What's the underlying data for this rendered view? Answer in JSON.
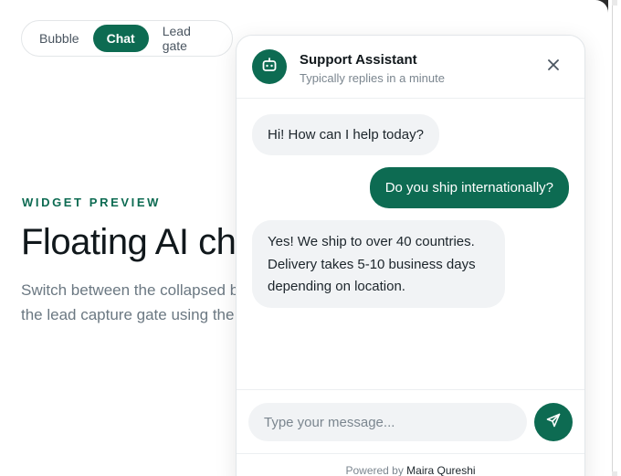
{
  "tabs": [
    {
      "label": "Bubble",
      "active": false
    },
    {
      "label": "Chat",
      "active": true
    },
    {
      "label": "Lead gate",
      "active": false
    }
  ],
  "hero": {
    "eyebrow": "WIDGET PREVIEW",
    "headline": "Floating AI cha",
    "desc_line1": "Switch between the collapsed b",
    "desc_line2": "the lead capture gate using the"
  },
  "widget": {
    "avatar_icon": "robot-icon",
    "title": "Support Assistant",
    "subtitle": "Typically replies in a minute",
    "close_icon": "close-icon",
    "messages": [
      {
        "role": "bot",
        "text": "Hi! How can I help today?"
      },
      {
        "role": "user",
        "text": "Do you ship internationally?"
      },
      {
        "role": "bot",
        "lines": [
          "Yes! We ship to over 40 countries.",
          "Delivery takes 5-10 business days",
          "depending on location."
        ]
      }
    ],
    "input_placeholder": "Type your message...",
    "send_icon": "send-icon",
    "footer_prefix": "Powered by",
    "footer_brand": "Maira Qureshi"
  },
  "colors": {
    "accent": "#0d6b52",
    "bot_bubble": "#f1f3f5",
    "text_muted": "#7b868f"
  }
}
